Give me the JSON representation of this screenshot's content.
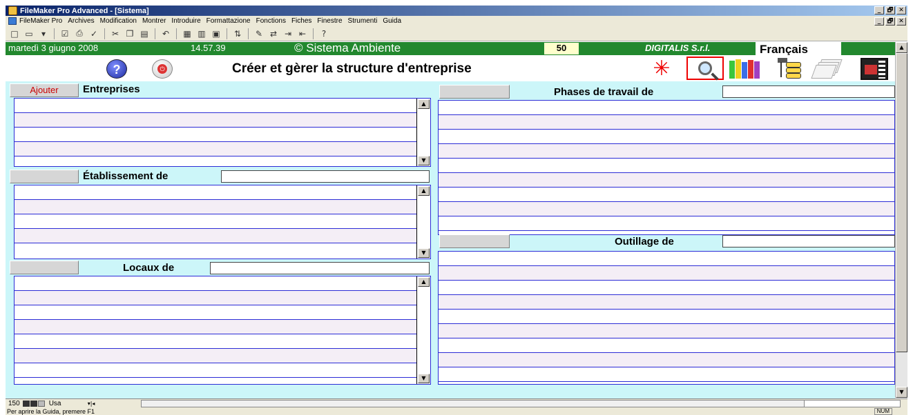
{
  "window": {
    "title": "FileMaker Pro Advanced - [Sistema]",
    "buttons": [
      "_",
      "🗗",
      "✕"
    ]
  },
  "menubar": {
    "items": [
      "FileMaker Pro",
      "Archives",
      "Modification",
      "Montrer",
      "Introduire",
      "Formattazione",
      "Fonctions",
      "Fiches",
      "Finestre",
      "Strumenti",
      "Guida"
    ]
  },
  "toolbar": {
    "icons": [
      "new-icon",
      "open-icon",
      "check-icon",
      "print-icon",
      "spell-icon",
      "cut-icon",
      "copy-icon",
      "paste-icon",
      "undo-icon",
      "layout-icon",
      "browse-icon",
      "find-icon",
      "sort-icon",
      "script-icon",
      "relations-icon",
      "import-icon",
      "export-icon",
      "help-icon"
    ]
  },
  "header": {
    "date": "martedì 3 giugno 2008",
    "time": "14.57.39",
    "copyright": "© Sistema Ambiente",
    "count": "50",
    "company": "DIGITALIS S.r.l.",
    "language": "Français",
    "page_title": "Créer et gèrer la structure d'entreprise",
    "help_glyph": "?"
  },
  "sections": {
    "entreprises": {
      "button": "Ajouter",
      "label": "Entreprises",
      "rows": 5
    },
    "etablissement": {
      "button": "",
      "label": "Établissement de",
      "rows": 5
    },
    "locaux": {
      "button": "",
      "label": "Locaux de",
      "rows": 8
    },
    "phases": {
      "button": "",
      "label": "Phases de travail de",
      "rows": 9
    },
    "outillage": {
      "button": "",
      "label": "Outillage de",
      "rows": 9
    }
  },
  "bottombar": {
    "zoom": "150",
    "mode": "Usa"
  },
  "statusbar": {
    "message": "Per aprire la Guida, premere F1",
    "num": "NUM"
  },
  "colors": {
    "header_bg": "#22882e",
    "content_bg": "#ccf6f9",
    "list_border": "#2b2bd6",
    "accent_red": "#c00000"
  }
}
